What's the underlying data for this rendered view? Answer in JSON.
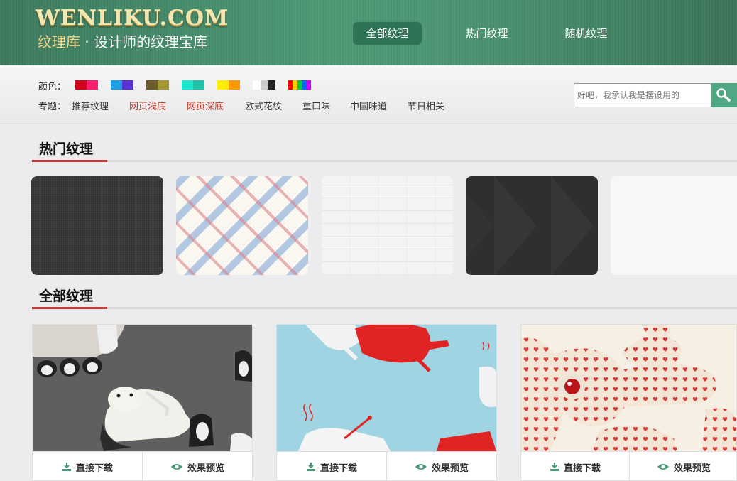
{
  "header": {
    "logo_text": "WENLIKU.COM",
    "tagline_prefix": "纹理库",
    "tagline_dot": "·",
    "tagline_rest": "设计师的纹理宝库",
    "nav": [
      {
        "label": "全部纹理",
        "active": true
      },
      {
        "label": "热门纹理",
        "active": false
      },
      {
        "label": "随机纹理",
        "active": false
      }
    ]
  },
  "filters": {
    "color_label": "颜色：",
    "topic_label": "专题：",
    "topics": [
      {
        "label": "推荐纹理",
        "highlight": false
      },
      {
        "label": "网页浅底",
        "highlight": true
      },
      {
        "label": "网页深底",
        "highlight": true
      },
      {
        "label": "欧式花纹",
        "highlight": false
      },
      {
        "label": "重口味",
        "highlight": false
      },
      {
        "label": "中国味道",
        "highlight": false
      },
      {
        "label": "节日相关",
        "highlight": false
      }
    ],
    "color_swatches": [
      [
        "#d0021b",
        "#ff1f6e"
      ],
      [
        "#20a0e0",
        "#5a2fd6"
      ],
      [
        "#6b5a2a",
        "#a39a34"
      ],
      [
        "#1de8d2",
        "#22c2a8"
      ],
      [
        "#ffee00",
        "#ff9a00"
      ],
      [
        "#ffffff",
        "#cccccc",
        "#222222"
      ],
      [
        "#ff0000",
        "#ffcc00",
        "#00cc44",
        "#0066ff",
        "#cc00ff"
      ]
    ]
  },
  "search": {
    "placeholder": "好吧，我承认我是摆设用的"
  },
  "sections": {
    "hot_title": "热门纹理",
    "all_title": "全部纹理"
  },
  "card_actions": {
    "download": "直接下载",
    "preview": "效果预览"
  },
  "colors": {
    "header_green": "#4a9470",
    "accent_red": "#c83a36",
    "search_btn": "#4fa784",
    "icon_green": "#4a9a78"
  }
}
